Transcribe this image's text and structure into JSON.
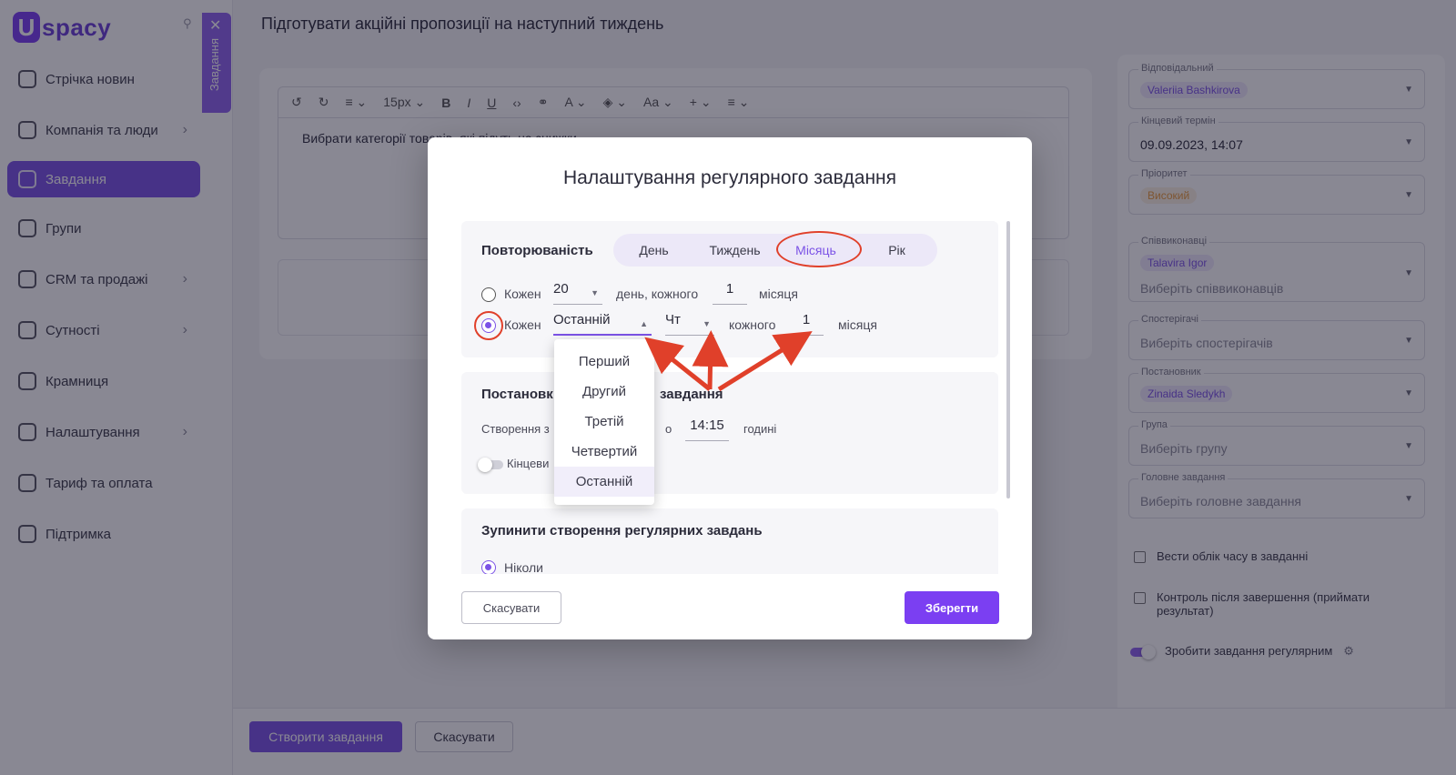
{
  "brand": {
    "logo_letter": "U",
    "logo_text": "spacy"
  },
  "sidebar": {
    "items": [
      {
        "label": "Стрічка новин"
      },
      {
        "label": "Компанія та люди"
      },
      {
        "label": "Завдання"
      },
      {
        "label": "Групи"
      },
      {
        "label": "CRM та продажі"
      },
      {
        "label": "Сутності"
      },
      {
        "label": "Крамниця"
      },
      {
        "label": "Налаштування"
      },
      {
        "label": "Тариф та оплата"
      },
      {
        "label": "Підтримка"
      }
    ],
    "tasks_tab": "Завдання"
  },
  "header": {
    "title": "Підготувати акційні пропозиції на наступний тиждень"
  },
  "editor": {
    "font_size": "15px",
    "text": "Вибрати категорії товарів, які підуть на знижки"
  },
  "right_panel": {
    "responsible_label": "Відповідальний",
    "responsible_value": "Valeriia Bashkirova",
    "deadline_label": "Кінцевий термін",
    "deadline_value": "09.09.2023, 14:07",
    "priority_label": "Пріоритет",
    "priority_value": "Високий",
    "coexecutors_label": "Співвиконавці",
    "coexecutors_value": "Talavira Igor",
    "coexecutors_placeholder": "Виберіть співвиконавців",
    "observers_label": "Спостерігачі",
    "observers_placeholder": "Виберіть спостерігачів",
    "creator_label": "Постановник",
    "creator_value": "Zinaida Sledykh",
    "group_label": "Група",
    "group_placeholder": "Виберіть групу",
    "parent_label": "Головне завдання",
    "parent_placeholder": "Виберіть головне завдання",
    "time_tracking": "Вести облік часу в завданні",
    "control_after": "Контроль після завершення (приймати результат)",
    "make_regular": "Зробити завдання регулярним"
  },
  "footer": {
    "create_button": "Створити завдання",
    "cancel_button": "Скасувати"
  },
  "modal": {
    "title": "Налаштування регулярного завдання",
    "repeat_label": "Повторюваність",
    "tabs": [
      {
        "label": "День"
      },
      {
        "label": "Тиждень"
      },
      {
        "label": "Місяць"
      },
      {
        "label": "Рік"
      }
    ],
    "option1": {
      "every": "Кожен",
      "day": "20",
      "day_text": "день, кожного",
      "months": "1",
      "month_text": "місяця"
    },
    "option2": {
      "every": "Кожен",
      "ordinal": "Останній",
      "weekday": "Чт",
      "every_text": "кожного",
      "months": "1",
      "month_text": "місяця"
    },
    "dropdown_options": [
      "Перший",
      "Другий",
      "Третій",
      "Четвертий",
      "Останній"
    ],
    "setup_title_left": "Постановк",
    "setup_title_right": "завдання",
    "creation_text": "Створення з",
    "at_text": "о",
    "time": "14:15",
    "hours_text": "годині",
    "deadline_text": "Кінцеви",
    "stop_title": "Зупинити створення регулярних завдань",
    "never": "Ніколи",
    "cancel": "Скасувати",
    "save": "Зберегти"
  },
  "colors": {
    "accent": "#7b52e6",
    "annotation": "#e0402a"
  }
}
